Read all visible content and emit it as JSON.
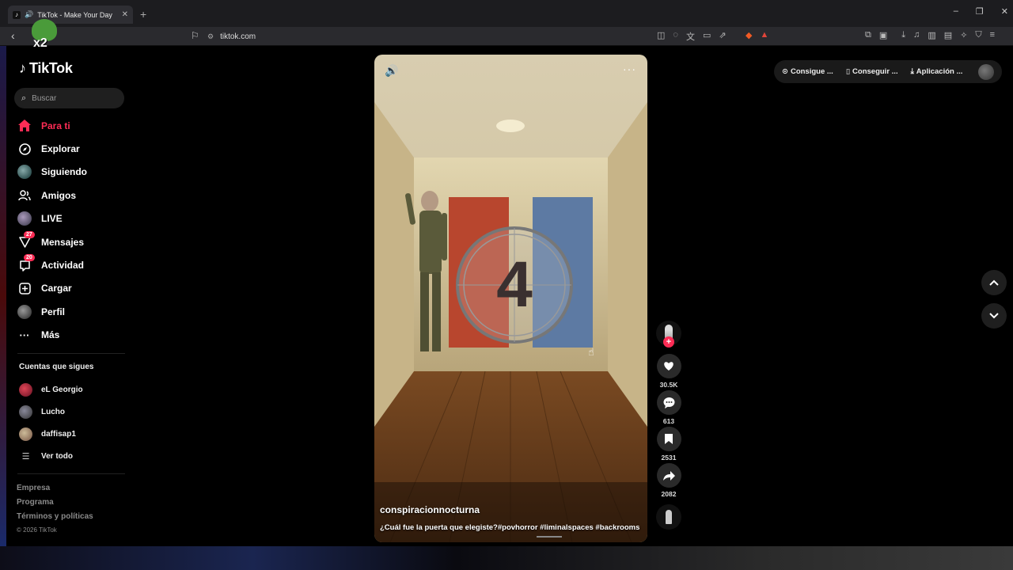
{
  "browser": {
    "tab_title": "TikTok - Make Your Day",
    "tab_close": "✕",
    "new_tab": "+",
    "url": "tiktok.com",
    "window_controls": [
      "–",
      "❐",
      "✕"
    ]
  },
  "sidebar": {
    "logo_text": "TikTok",
    "sticker_text": "x2",
    "search_placeholder": "Buscar",
    "nav": [
      {
        "label": "Para ti",
        "icon": "home-icon",
        "glyph": "⌂"
      },
      {
        "label": "Explorar",
        "icon": "compass-icon",
        "glyph": "⊘"
      },
      {
        "label": "Siguiendo",
        "icon": "following-avatar-icon",
        "glyph": ""
      },
      {
        "label": "Amigos",
        "icon": "friends-icon",
        "glyph": "👥"
      },
      {
        "label": "LIVE",
        "icon": "live-icon",
        "glyph": ""
      },
      {
        "label": "Mensajes",
        "icon": "messages-icon",
        "glyph": "✈",
        "badge": "27"
      },
      {
        "label": "Actividad",
        "icon": "activity-icon",
        "glyph": "▢",
        "badge": "20"
      },
      {
        "label": "Cargar",
        "icon": "upload-icon",
        "glyph": "⊞"
      },
      {
        "label": "Perfil",
        "icon": "profile-icon",
        "glyph": ""
      },
      {
        "label": "Más",
        "icon": "more-icon",
        "glyph": "···"
      }
    ],
    "following_title": "Cuentas que sigues",
    "following": [
      {
        "name": "eL Georgio",
        "color": "#b03040"
      },
      {
        "name": "Lucho",
        "color": "#555566"
      },
      {
        "name": "daffisap1",
        "color": "#a08060"
      }
    ],
    "see_all": "Ver todo",
    "footer": [
      "Empresa",
      "Programa",
      "Términos y políticas"
    ],
    "copyright": "© 2026 TikTok"
  },
  "top_actions": [
    {
      "label": "Consigue ...",
      "icon": "coin-icon",
      "glyph": "⊙"
    },
    {
      "label": "Conseguir ...",
      "icon": "phone-icon",
      "glyph": "▯"
    },
    {
      "label": "Aplicación ...",
      "icon": "download-icon",
      "glyph": "⤓"
    }
  ],
  "video": {
    "countdown": "4",
    "username": "conspiracionnocturna",
    "description": "¿Cuál fue la puerta que elegiste?#povhorror #liminalspaces #backrooms"
  },
  "actions": {
    "likes": "30.5K",
    "comments": "613",
    "saves": "2531",
    "shares": "2082"
  },
  "colors": {
    "accent": "#fe2c55"
  }
}
